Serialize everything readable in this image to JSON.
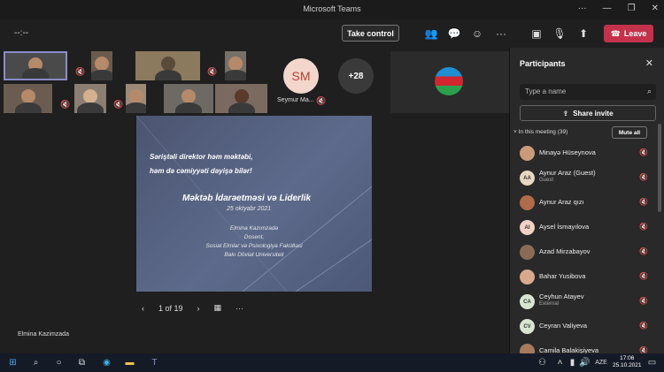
{
  "window": {
    "title": "Microsoft Teams"
  },
  "toolbar": {
    "timer": "--:--",
    "take_control": "Take control",
    "leave": "Leave"
  },
  "gallery": {
    "sm_initials": "SM",
    "sm_name": "Seymur Ma...",
    "overflow_count": "+28"
  },
  "slide": {
    "line1": "Səriştəli direktor həm məktəbi,",
    "line2": "həm də cəmiyyəti dəyişə bilər!",
    "title": "Məktəb İdarəetməsi və Liderlik",
    "date": "25 oktyabr 2021",
    "author_lines": [
      "Elmina Kazımzadə",
      "Dosent,",
      "Sosial Elmlər və Psixologiya Fakültəsi",
      "Bakı Dövlət Universiteti"
    ],
    "page": "1 of 19"
  },
  "presenter_name": "Elmina Kazimzada",
  "panel": {
    "title": "Participants",
    "search_placeholder": "Type a name",
    "share_invite": "Share invite",
    "in_meeting": "In this meeting (39)",
    "mute_all": "Mute all",
    "participants": [
      {
        "name": "Minayə Hüseynova",
        "initials": "",
        "color": "#c99b7a"
      },
      {
        "name": "Aynur Araz (Guest)",
        "initials": "AA",
        "color": "#e8d7c2",
        "sub": "Guest"
      },
      {
        "name": "Aynur Araz qızı",
        "initials": "",
        "color": "#b06b4a"
      },
      {
        "name": "Aysel İsmayılova",
        "initials": "AI",
        "color": "#f2d3c6"
      },
      {
        "name": "Azad Mirzabayov",
        "initials": "",
        "color": "#8a6b55"
      },
      {
        "name": "Bahar Yusibova",
        "initials": "",
        "color": "#d9a98c"
      },
      {
        "name": "Ceyhun Atayev",
        "initials": "CA",
        "color": "#d8e6d0",
        "sub": "External"
      },
      {
        "name": "Ceyran Valiyeva",
        "initials": "CV",
        "color": "#d8e6d0"
      },
      {
        "name": "Camila Balakişiyeva",
        "initials": "",
        "color": "#a77a5e"
      }
    ]
  },
  "taskbar": {
    "lang": "AZE",
    "time": "17:06",
    "date": "25.10.2021"
  }
}
